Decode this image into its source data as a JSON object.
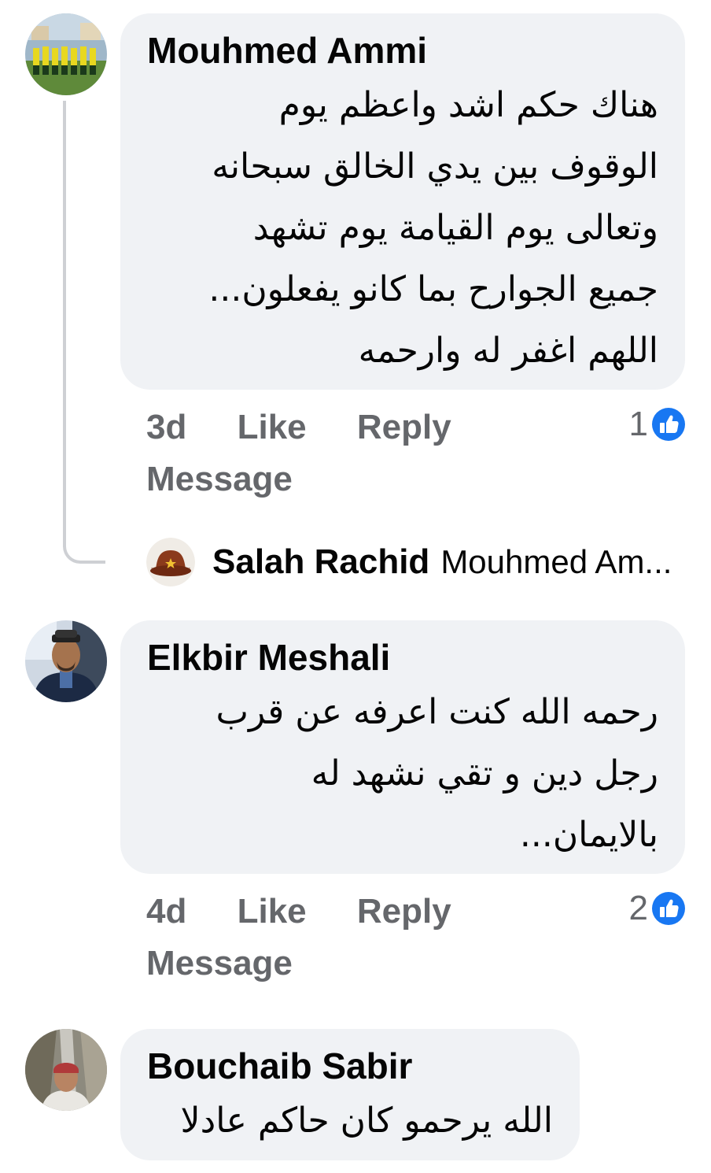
{
  "comments": [
    {
      "author": "Mouhmed Ammi",
      "lines": [
        "هناك حكم اشد واعظم يوم",
        "الوقوف بين يدي الخالق سبحانه",
        "وتعالى يوم القيامة يوم تشهد",
        "جميع الجوارح بما كانو يفعلون...",
        "اللهم اغفر له وارحمه"
      ],
      "time": "3d",
      "like": "Like",
      "reply": "Reply",
      "message": "Message",
      "reaction_count": "1"
    },
    {
      "author": "Elkbir Meshali",
      "lines": [
        "رحمه الله كنت اعرفه عن قرب",
        "رجل دين و تقي نشهد له",
        "بالايمان..."
      ],
      "time": "4d",
      "like": "Like",
      "reply": "Reply",
      "message": "Message",
      "reaction_count": "2"
    },
    {
      "author": "Bouchaib Sabir",
      "lines": [
        "الله يرحمو كان حاكم عادلا"
      ]
    }
  ],
  "reply_preview": {
    "author": "Salah Rachid",
    "text": "Mouhmed Am..."
  },
  "colors": {
    "bubble": "#f0f2f5",
    "meta_text": "#65676b",
    "like_blue": "#1877f2",
    "thread_line": "#ced0d4"
  },
  "icons": [
    "like-reaction-icon",
    "avatar"
  ]
}
